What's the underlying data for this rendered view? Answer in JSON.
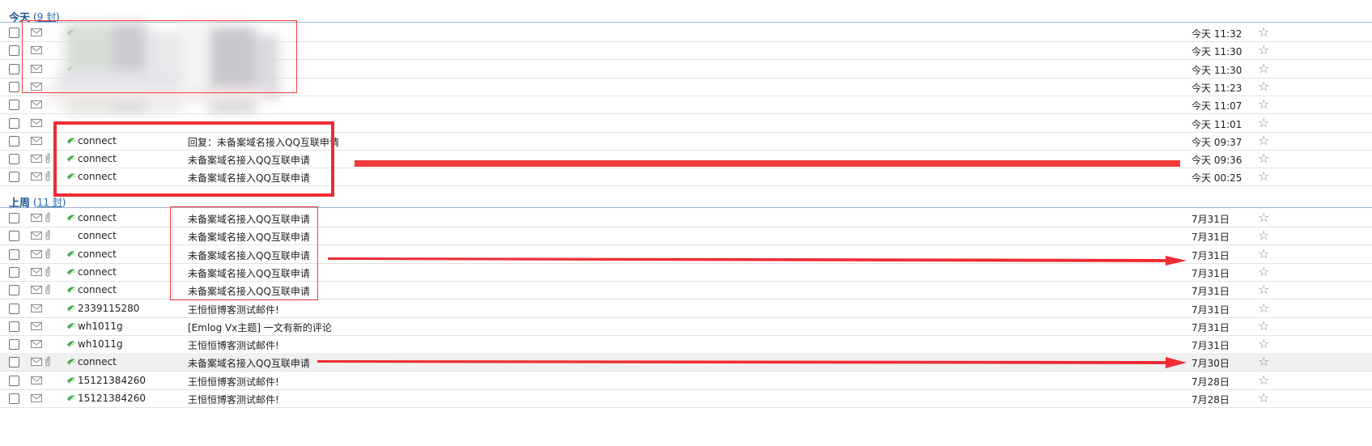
{
  "groups": [
    {
      "title": "今天",
      "count_prefix": "(",
      "count_num": "9 封",
      "count_suffix": ")"
    },
    {
      "title": "上周",
      "count_prefix": "(",
      "count_num": "11 封",
      "count_suffix": ")"
    }
  ],
  "today_rows": [
    {
      "sender": "",
      "subject": "",
      "time": "今天 11:32",
      "has_qq": true
    },
    {
      "sender": "",
      "subject": "",
      "time": "今天 11:30",
      "has_qq": false
    },
    {
      "sender": "",
      "subject": "",
      "time": "今天 11:30",
      "has_qq": true
    },
    {
      "sender": "",
      "subject": "",
      "time": "今天 11:23",
      "has_qq": false
    },
    {
      "sender": "",
      "subject": "",
      "time": "今天 11:07",
      "has_qq": false
    },
    {
      "sender": "",
      "subject": "",
      "time": "今天 11:01",
      "has_qq": false
    },
    {
      "sender": "connect",
      "subject": "回复：未备案域名接入QQ互联申请",
      "time": "今天 09:37",
      "has_qq": true
    },
    {
      "sender": "connect",
      "subject": "未备案域名接入QQ互联申请",
      "time": "今天 09:36",
      "has_qq": true
    },
    {
      "sender": "connect",
      "subject": "未备案域名接入QQ互联申请",
      "time": "今天 00:25",
      "has_qq": true
    }
  ],
  "lastweek_rows": [
    {
      "sender": "connect",
      "subject": "未备案域名接入QQ互联申请",
      "time": "7月31日",
      "has_qq": true
    },
    {
      "sender": "connect",
      "subject": "未备案域名接入QQ互联申请",
      "time": "7月31日",
      "has_qq": false
    },
    {
      "sender": "connect",
      "subject": "未备案域名接入QQ互联申请",
      "time": "7月31日",
      "has_qq": true
    },
    {
      "sender": "connect",
      "subject": "未备案域名接入QQ互联申请",
      "time": "7月31日",
      "has_qq": true
    },
    {
      "sender": "connect",
      "subject": "未备案域名接入QQ互联申请",
      "time": "7月31日",
      "has_qq": true
    },
    {
      "sender": "2339115280",
      "subject": "王恒恒博客测试邮件!",
      "time": "7月31日",
      "has_qq": true
    },
    {
      "sender": "wh1011g",
      "subject": "[Emlog Vx主题] 一文有新的评论",
      "time": "7月31日",
      "has_qq": true
    },
    {
      "sender": "wh1011g",
      "subject": "王恒恒博客测试邮件!",
      "time": "7月31日",
      "has_qq": true
    },
    {
      "sender": "connect",
      "subject": "未备案域名接入QQ互联申请",
      "time": "7月30日",
      "has_qq": true
    },
    {
      "sender": "15121384260",
      "subject": "王恒恒博客测试邮件!",
      "time": "7月28日",
      "has_qq": true
    },
    {
      "sender": "15121384260",
      "subject": "王恒恒博客测试邮件!",
      "time": "7月28日",
      "has_qq": true
    }
  ],
  "icons": {
    "checkbox": "checkbox",
    "envelope": "envelope-icon",
    "attachment": "paperclip-icon",
    "qq": "qq-mark-icon",
    "star": "star-icon"
  },
  "colors": {
    "group_title": "#1e5494",
    "annotation_red": "#ef2c34",
    "divider": "#9cb8d6"
  }
}
